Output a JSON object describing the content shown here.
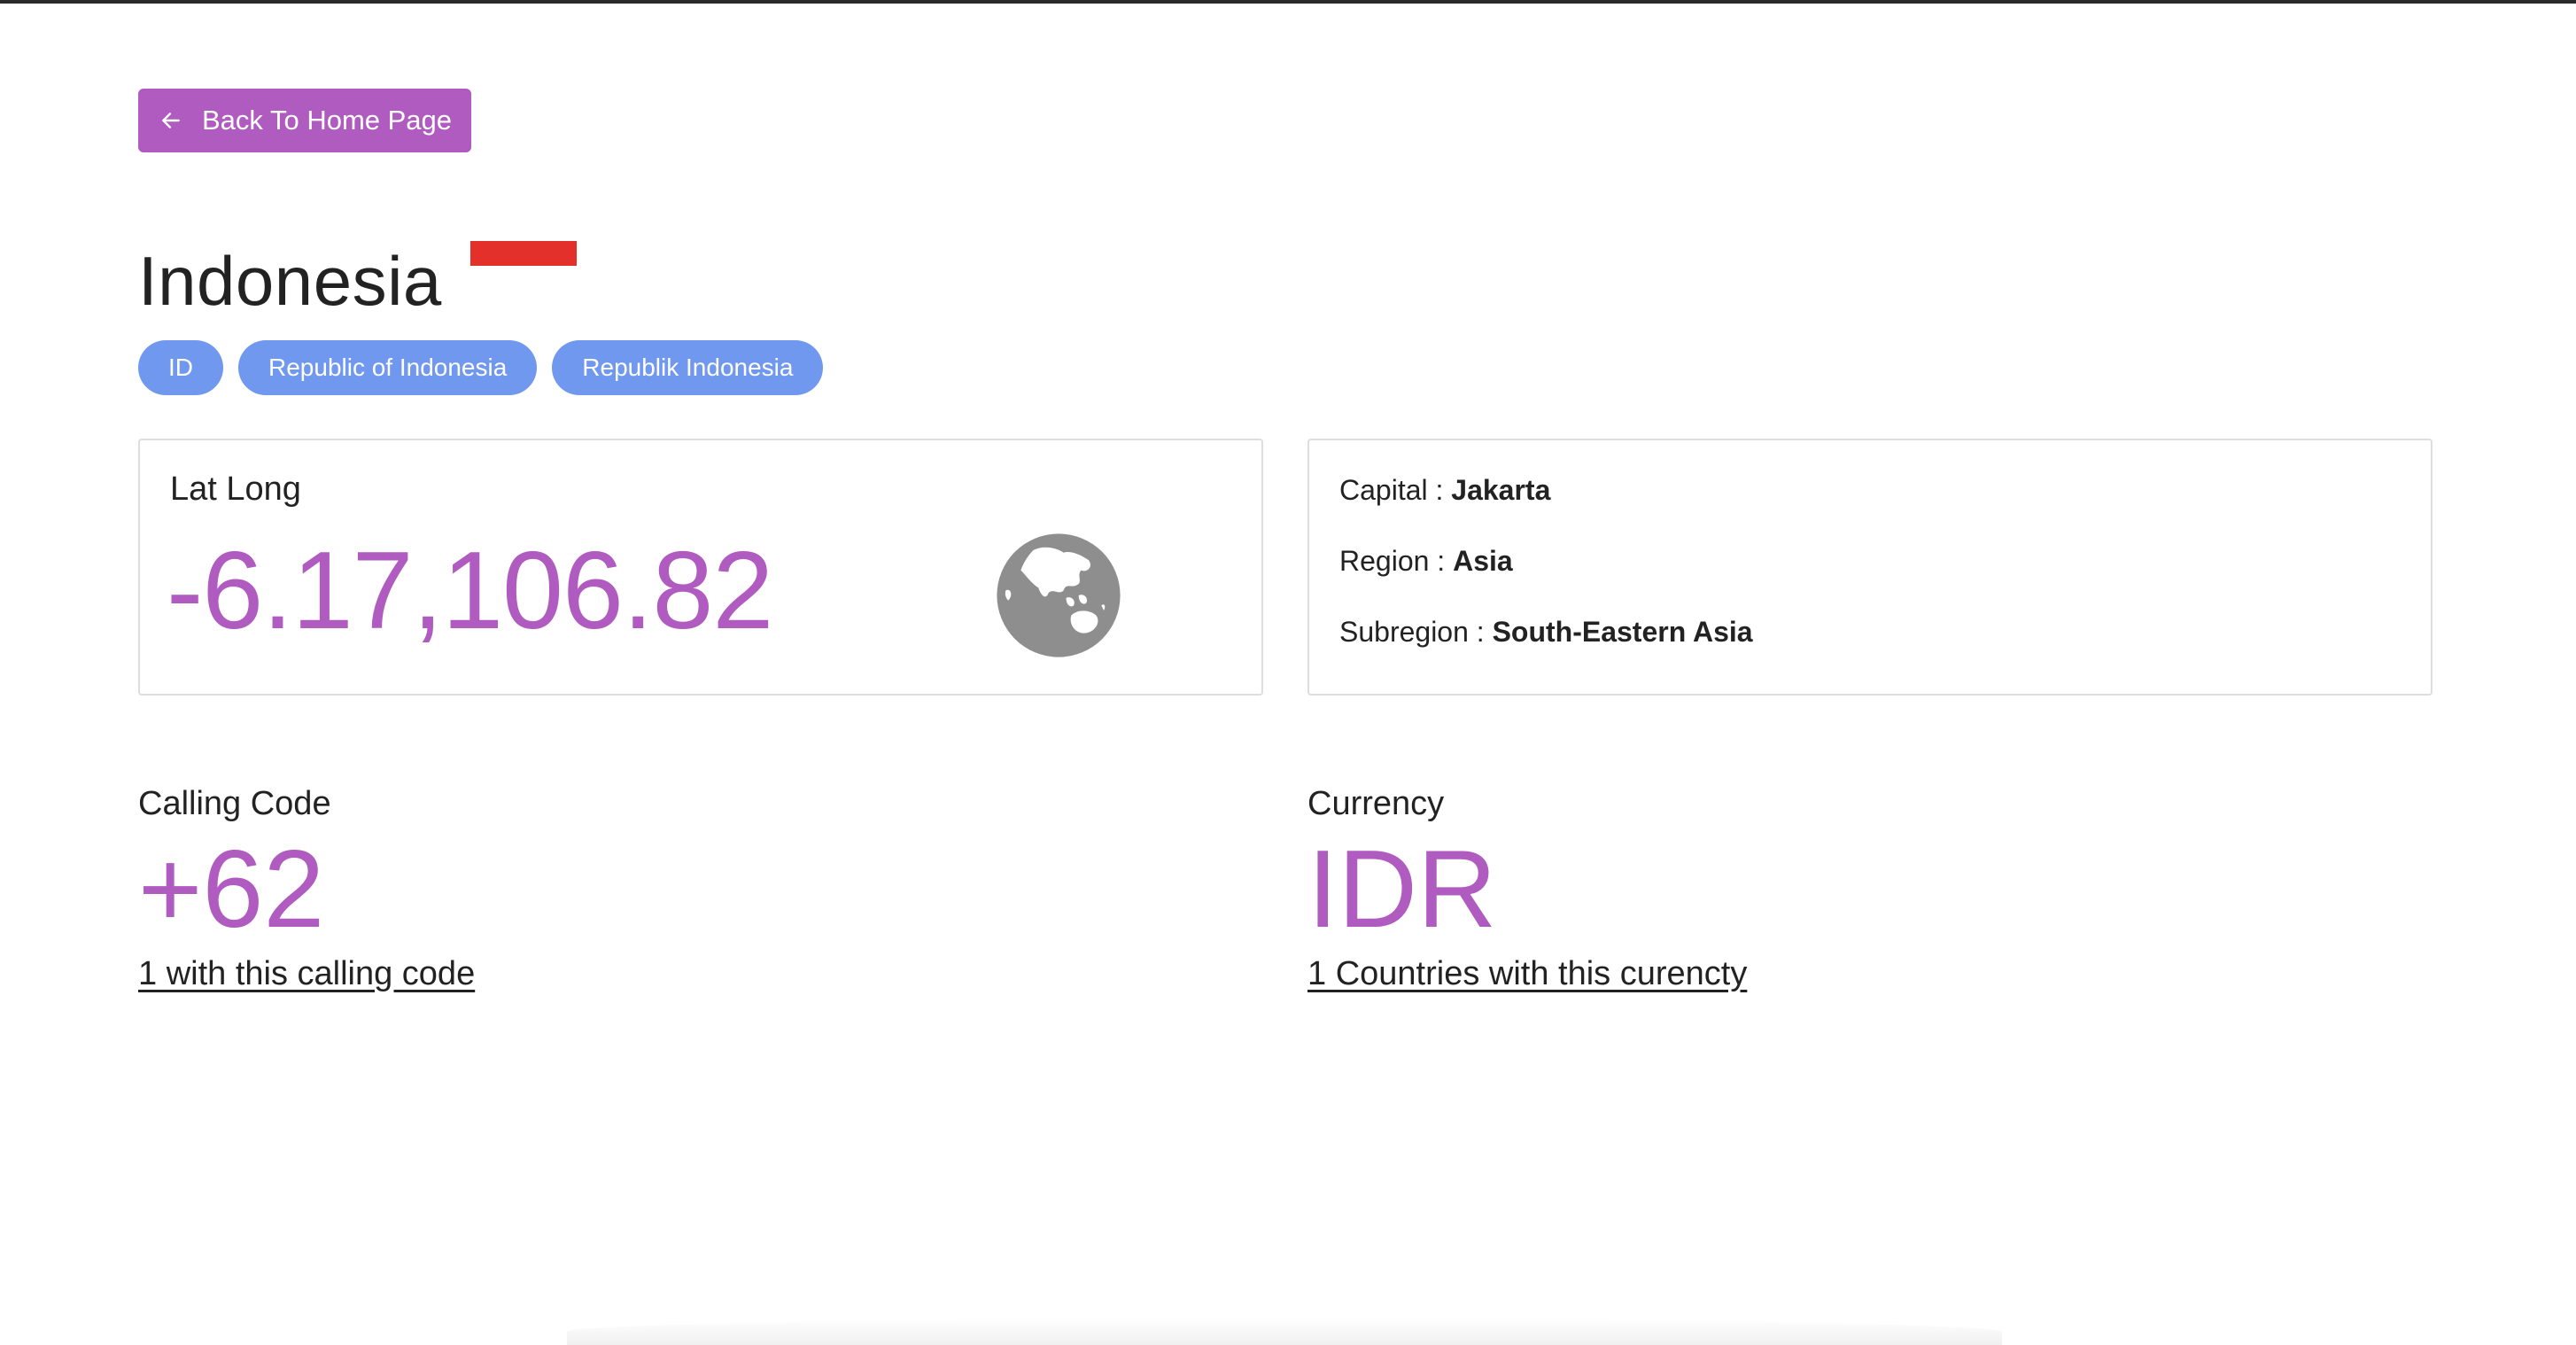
{
  "back_button": {
    "label": "Back To Home Page",
    "icon": "arrow-left-icon"
  },
  "country": {
    "name": "Indonesia",
    "flag_colors": [
      "#e3302a",
      "#ffffff"
    ]
  },
  "badges": [
    {
      "label": "ID"
    },
    {
      "label": "Republic of Indonesia"
    },
    {
      "label": "Republik Indonesia"
    }
  ],
  "latlong_card": {
    "label": "Lat Long",
    "value": "-6.17,106.82",
    "icon": "globe-asia-icon"
  },
  "info_card": {
    "capital_label": "Capital : ",
    "capital_value": "Jakarta",
    "region_label": "Region : ",
    "region_value": "Asia",
    "subregion_label": "Subregion : ",
    "subregion_value": "South-Eastern Asia"
  },
  "calling_code": {
    "label": "Calling Code",
    "value": "+62",
    "link": "1 with this calling code"
  },
  "currency": {
    "label": "Currency",
    "value": "IDR",
    "link": "1 Countries with this curencty"
  },
  "colors": {
    "accent": "#b05bbf",
    "badge": "#6f98ee",
    "flag_red": "#e3302a"
  }
}
